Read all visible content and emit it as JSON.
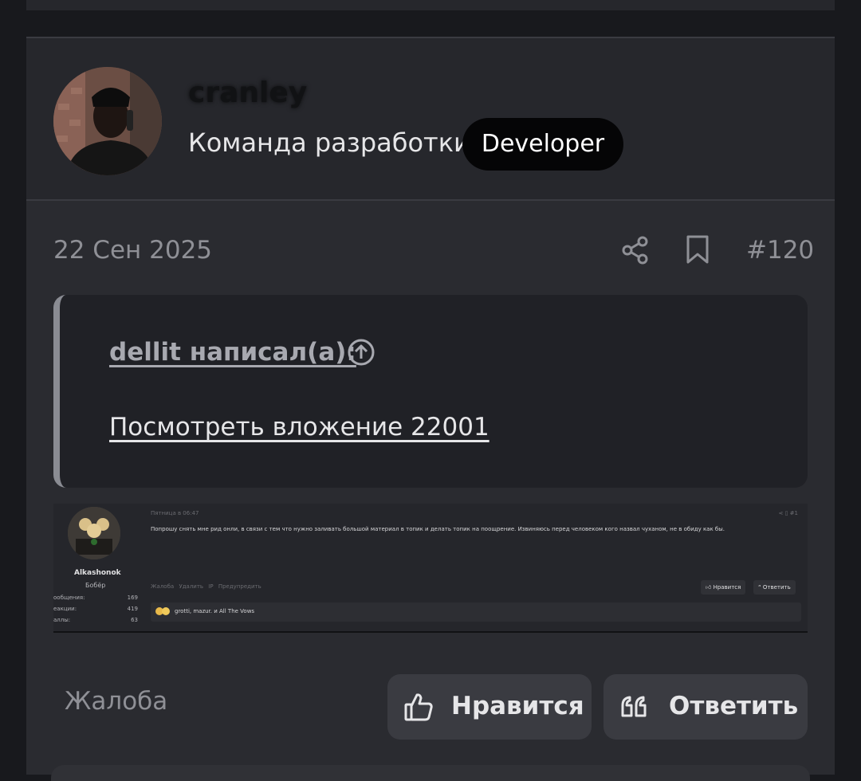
{
  "author": {
    "username": "cranley",
    "role": "Команда разработки",
    "badge": "Developer"
  },
  "meta": {
    "date": "22 Сен 2025",
    "post_number": "#120"
  },
  "quote": {
    "author_label": "dellit написал(а):",
    "link_text": "Посмотреть вложение 22001"
  },
  "attachment": {
    "name": "Alkashonok",
    "rank": "Бобёр",
    "stats": [
      {
        "label": "ообщения:",
        "value": "169"
      },
      {
        "label": "еакции:",
        "value": "419"
      },
      {
        "label": "аллы:",
        "value": "63"
      }
    ],
    "date": "Пятница в 06:47",
    "post_number": "#1",
    "text": "Попрошу снять мне рид онли, в связи с тем что нужно заливать большой материал в топик и делать топик на поощрение. Извиняюсь перед человеком кого назвал чуханом, не в обиду как бы.",
    "actions": [
      "Жалоба",
      "Удалить",
      "IP",
      "Предупредить"
    ],
    "like_label": "Нравится",
    "reply_label": "Ответить",
    "reactions_text": "grotti, mazur. и All The Vows"
  },
  "footer": {
    "report_label": "Жалоба",
    "like_label": "Нравится",
    "reply_label": "Ответить"
  }
}
